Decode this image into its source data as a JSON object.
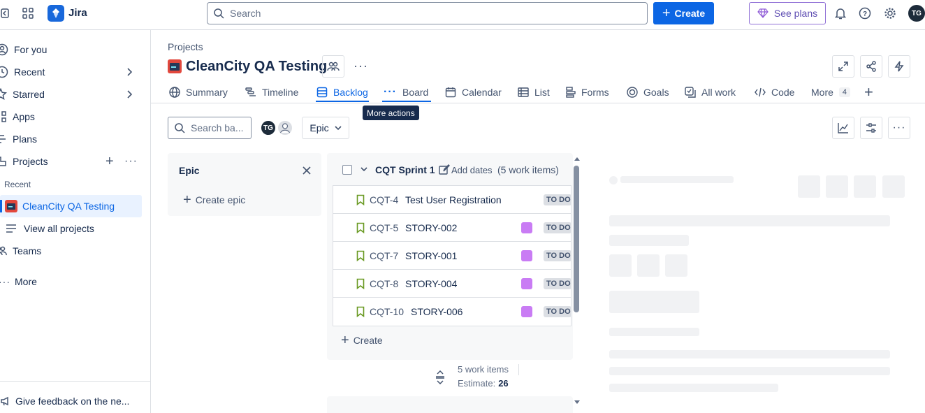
{
  "topbar": {
    "app_name": "Jira",
    "search_placeholder": "Search",
    "create_label": "Create",
    "see_plans_label": "See plans",
    "avatar_initials": "TG"
  },
  "sidebar": {
    "items": [
      {
        "label": "For you",
        "icon": "person-icon"
      },
      {
        "label": "Recent",
        "icon": "clock-icon"
      },
      {
        "label": "Starred",
        "icon": "star-icon"
      },
      {
        "label": "Apps",
        "icon": "apps-icon"
      },
      {
        "label": "Plans",
        "icon": "plans-icon"
      },
      {
        "label": "Projects",
        "icon": "projects-icon"
      }
    ],
    "recent_heading": "Recent",
    "recent_project": "CleanCity QA Testing",
    "view_all_projects": "View all projects",
    "teams": "Teams",
    "more": "More",
    "feedback": "Give feedback on the ne..."
  },
  "header": {
    "breadcrumb": "Projects",
    "project_title": "CleanCity QA Testing",
    "tooltip": "More actions"
  },
  "tabs": [
    {
      "label": "Summary",
      "icon": "globe-icon"
    },
    {
      "label": "Timeline",
      "icon": "timeline-icon"
    },
    {
      "label": "Backlog",
      "icon": "backlog-icon",
      "active": true
    },
    {
      "label": "Board",
      "icon": "board-icon"
    },
    {
      "label": "Calendar",
      "icon": "calendar-icon"
    },
    {
      "label": "List",
      "icon": "list-icon"
    },
    {
      "label": "Forms",
      "icon": "forms-icon"
    },
    {
      "label": "Goals",
      "icon": "goals-icon"
    },
    {
      "label": "All work",
      "icon": "all-work-icon"
    },
    {
      "label": "Code",
      "icon": "code-icon"
    }
  ],
  "more_tab": {
    "label": "More",
    "count": "4"
  },
  "toolbar": {
    "search_placeholder": "Search ba...",
    "avatar_initials": "TG",
    "epic_filter_label": "Epic"
  },
  "epic_panel": {
    "title": "Epic",
    "create_epic": "Create epic"
  },
  "sprint": {
    "name": "CQT Sprint 1",
    "add_dates": "Add dates",
    "count_label": "(5 work items)",
    "items": [
      {
        "key": "CQT-4",
        "summary": "Test User Registration",
        "status": "TO DO",
        "has_epic": false
      },
      {
        "key": "CQT-5",
        "summary": "STORY-002",
        "status": "TO DO",
        "has_epic": true
      },
      {
        "key": "CQT-7",
        "summary": "STORY-001",
        "status": "TO DO",
        "has_epic": true
      },
      {
        "key": "CQT-8",
        "summary": "STORY-004",
        "status": "TO DO",
        "has_epic": true
      },
      {
        "key": "CQT-10",
        "summary": "STORY-006",
        "status": "TO DO",
        "has_epic": true
      }
    ],
    "create_label": "Create",
    "footer_items": "5 work items",
    "footer_estimate_label": "Estimate:",
    "footer_estimate_value": "26"
  },
  "colors": {
    "accent": "#0c66e4",
    "epic": "#c97cf4",
    "story_icon": "#6a9a23"
  }
}
